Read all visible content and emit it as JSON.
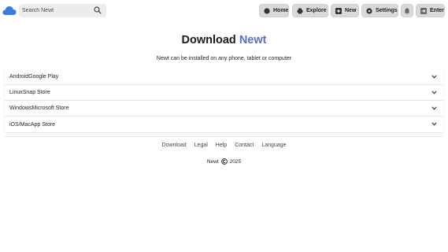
{
  "header": {
    "logo_icon": "cloud-icon",
    "search": {
      "placeholder": "Search Newt",
      "value": ""
    },
    "nav": [
      {
        "label": "Home",
        "icon": "home-icon"
      },
      {
        "label": "Explore",
        "icon": "printer-icon"
      },
      {
        "label": "New",
        "icon": "plus-icon"
      },
      {
        "label": "Settings",
        "icon": "gear-icon"
      },
      {
        "label": "",
        "icon": "bell-icon"
      },
      {
        "label": "Enter",
        "icon": "enter-icon"
      }
    ]
  },
  "main": {
    "title_prefix": "Download",
    "title_brand": "Newt",
    "subtitle": "Newt can be installed on any phone, tablet or computer",
    "platforms": [
      {
        "label": "AndroidGoogle Play"
      },
      {
        "label": "LinuxSnap Store"
      },
      {
        "label": "WindowsMicrosoft Store"
      },
      {
        "label": "iOS/MacApp Store"
      }
    ]
  },
  "footer": {
    "links": [
      "Download",
      "Legal",
      "Help",
      "Contact",
      "Language"
    ],
    "brand": "Newt",
    "year": "2025"
  },
  "colors": {
    "brand": "#5b6fc4",
    "button_bg": "#d9d9d9",
    "search_bg": "#ededed",
    "logo": "#3b7dd8"
  }
}
